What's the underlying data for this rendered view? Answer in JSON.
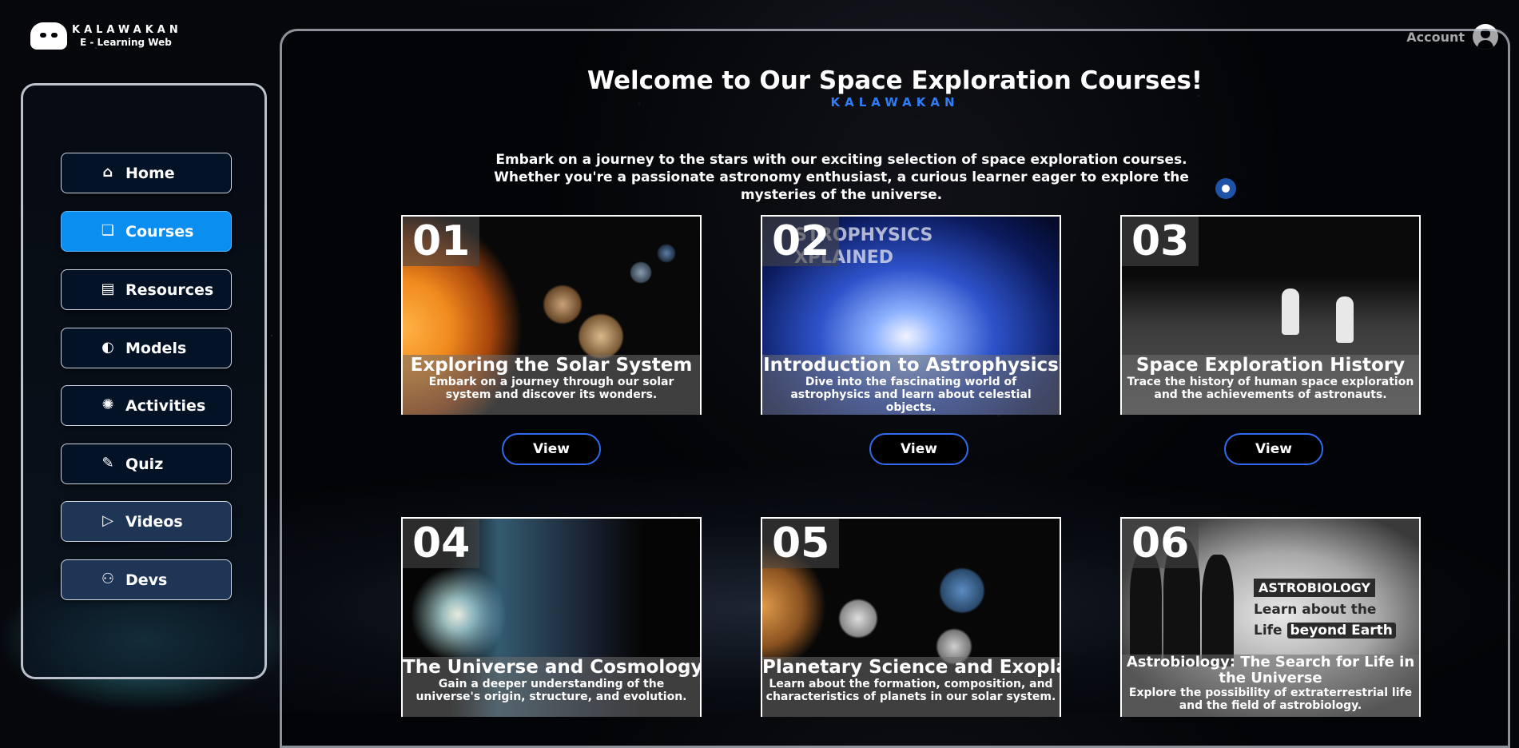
{
  "brand": {
    "title": "KALAWAKAN",
    "subtitle": "E - Learning Web"
  },
  "account": {
    "label": "Account",
    "icon": "account-circle-icon"
  },
  "sidebar": {
    "items": [
      {
        "label": "Home",
        "icon": "home-icon",
        "glyph": "⌂",
        "active": false
      },
      {
        "label": "Courses",
        "icon": "courses-icon",
        "glyph": "❏",
        "active": true
      },
      {
        "label": "Resources",
        "icon": "pdf-file-icon",
        "glyph": "▤",
        "active": false
      },
      {
        "label": "Models",
        "icon": "planet-icon",
        "glyph": "◐",
        "active": false
      },
      {
        "label": "Activities",
        "icon": "galaxy-icon",
        "glyph": "✺",
        "active": false
      },
      {
        "label": "Quiz",
        "icon": "pencil-icon",
        "glyph": "✎",
        "active": false
      },
      {
        "label": "Videos",
        "icon": "play-video-icon",
        "glyph": "▷",
        "active": false
      },
      {
        "label": "Devs",
        "icon": "people-icon",
        "glyph": "⚇",
        "active": false
      }
    ]
  },
  "main": {
    "title": "Welcome to Our Space Exploration Courses!",
    "subtitle": "KALAWAKAN",
    "intro": "Embark on a journey to the stars with our exciting selection of space exploration courses. Whether you're a passionate astronomy enthusiast, a curious learner eager to explore the mysteries of the universe.",
    "view_label": "View",
    "courses": [
      {
        "number": "01",
        "title": "Exploring the Solar System",
        "description": "Embark on a journey through our solar system and discover its wonders."
      },
      {
        "number": "02",
        "title": "Introduction to Astrophysics",
        "description": "Dive into the fascinating world of astrophysics and learn about celestial objects.",
        "image_text": "STROPHYSICS XPLAINED"
      },
      {
        "number": "03",
        "title": "Space Exploration History",
        "description": "Trace the history of human space exploration and the achievements of astronauts."
      },
      {
        "number": "04",
        "title": "The Universe and Cosmology",
        "description": "Gain a deeper understanding of the universe's origin, structure, and evolution."
      },
      {
        "number": "05",
        "title": "Planetary Science and Exoplanets",
        "description": "Learn about the formation, composition, and characteristics of planets in our solar system."
      },
      {
        "number": "06",
        "title": "Astrobiology: The Search for Life in the Universe",
        "description": "Explore the possibility of extraterrestrial life and the field of astrobiology.",
        "image_tag": "ASTROBIOLOGY",
        "image_line1": "Learn about the",
        "image_line2a": "Life",
        "image_line2b": "beyond Earth"
      }
    ]
  }
}
